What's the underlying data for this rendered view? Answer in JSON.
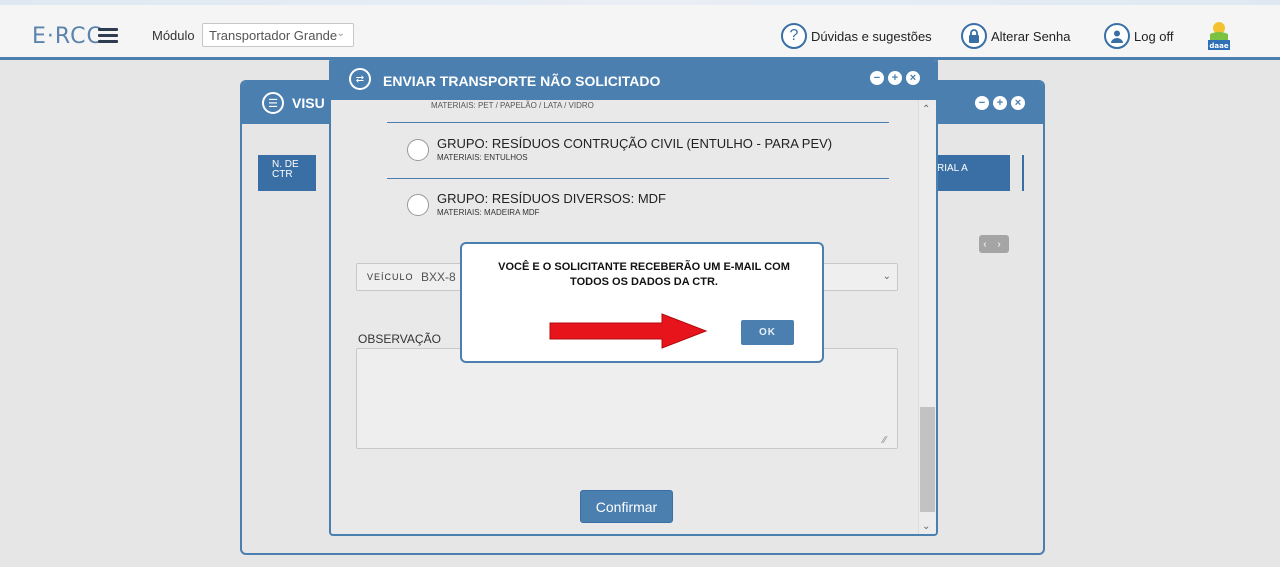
{
  "header": {
    "logo": "E·RCC",
    "modulo_label": "Módulo",
    "modulo_value": "Transportador Grande",
    "duvidas_label": "Dúvidas e sugestões",
    "alterar_senha_label": "Alterar Senha",
    "logoff_label": "Log off",
    "daae_label": "daae"
  },
  "background_window": {
    "title": "VISU",
    "col_left": [
      "N. DE",
      "CTR"
    ],
    "col_right": "RIAL A"
  },
  "dialog": {
    "title": "ENVIAR TRANSPORTE NÃO SOLICITADO",
    "cutoff_text": "MATERIAIS: PET / PAPELÃO / LATA / VIDRO",
    "groups": [
      {
        "title": "GRUPO: RESÍDUOS CONTRUÇÃO CIVIL (ENTULHO - PARA PEV)",
        "materials": "MATERIAIS: ENTULHOS"
      },
      {
        "title": "GRUPO: RESÍDUOS DIVERSOS: MDF",
        "materials": "MATERIAIS: MADEIRA MDF"
      }
    ],
    "veiculo_label": "VEÍCULO",
    "veiculo_value": "BXX-8",
    "observacao_label": "OBSERVAÇÃO",
    "observacao_value": "",
    "confirm_label": "Confirmar"
  },
  "alert": {
    "message": "VOCÊ E O SOLICITANTE RECEBERÃO UM E-MAIL COM TODOS OS DADOS DA CTR.",
    "ok_label": "OK"
  },
  "colors": {
    "primary": "#4a7fb0",
    "arrow": "#e8141b"
  }
}
